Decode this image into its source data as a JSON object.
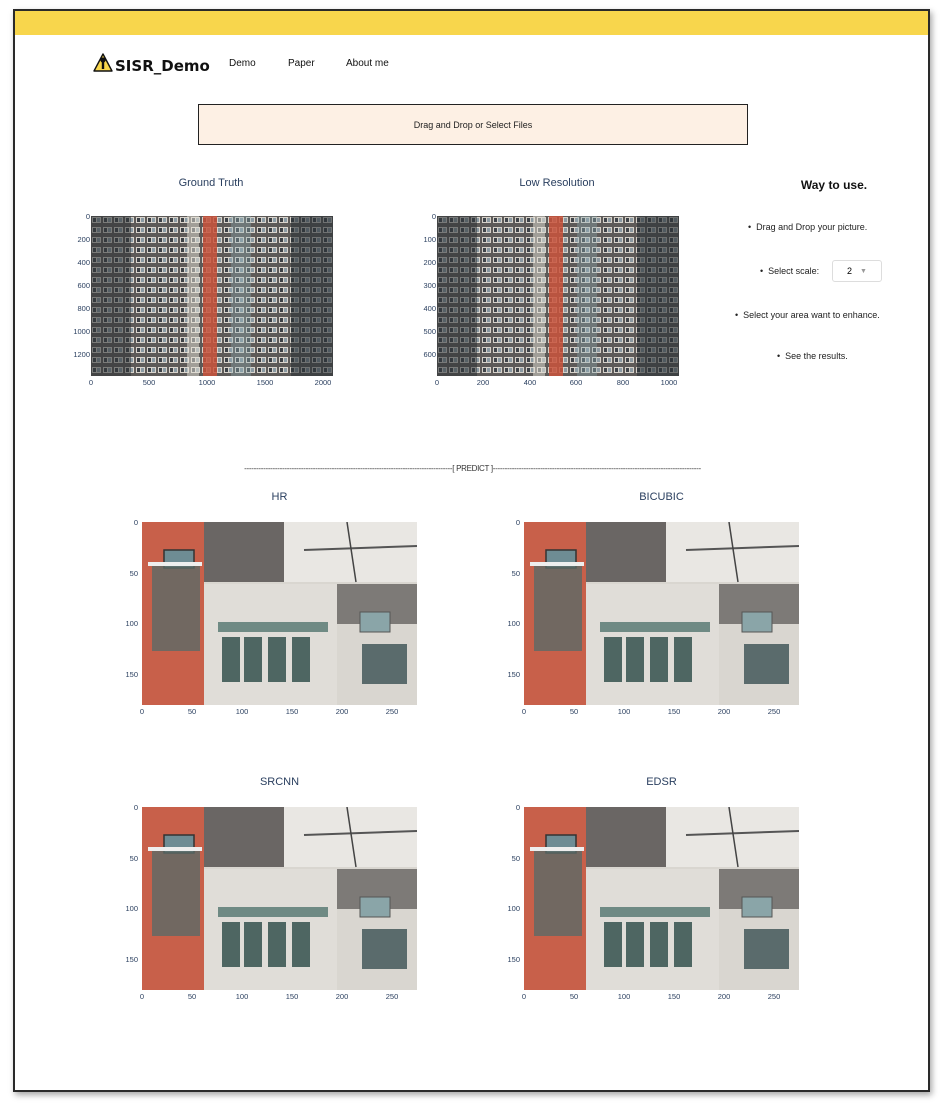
{
  "app": {
    "name": "SISR_Demo"
  },
  "nav": {
    "items": [
      "Demo",
      "Paper",
      "About me"
    ]
  },
  "upload": {
    "label": "Drag and Drop or Select Files"
  },
  "top_plots": [
    {
      "title": "Ground Truth",
      "yticks": [
        "0",
        "200",
        "400",
        "600",
        "800",
        "1000",
        "1200"
      ],
      "xticks": [
        "0",
        "500",
        "1000",
        "1500",
        "2000"
      ]
    },
    {
      "title": "Low Resolution",
      "yticks": [
        "0",
        "100",
        "200",
        "300",
        "400",
        "500",
        "600"
      ],
      "xticks": [
        "0",
        "200",
        "400",
        "600",
        "800",
        "1000"
      ]
    }
  ],
  "instructions": {
    "title": "Way to use.",
    "items": [
      "Drag and Drop your picture.",
      "Select scale:",
      "Select your area want to enhance.",
      "See the results."
    ],
    "scale_value": "2"
  },
  "divider": {
    "label": "[ PREDICT ]"
  },
  "predict_plots": [
    {
      "title": "HR",
      "yticks": [
        "0",
        "50",
        "100",
        "150"
      ],
      "xticks": [
        "0",
        "50",
        "100",
        "150",
        "200",
        "250"
      ]
    },
    {
      "title": "BICUBIC",
      "yticks": [
        "0",
        "50",
        "100",
        "150"
      ],
      "xticks": [
        "0",
        "50",
        "100",
        "150",
        "200",
        "250"
      ]
    },
    {
      "title": "SRCNN",
      "yticks": [
        "0",
        "50",
        "100",
        "150"
      ],
      "xticks": [
        "0",
        "50",
        "100",
        "150",
        "200",
        "250"
      ]
    },
    {
      "title": "EDSR",
      "yticks": [
        "0",
        "50",
        "100",
        "150"
      ],
      "xticks": [
        "0",
        "50",
        "100",
        "150",
        "200",
        "250"
      ]
    }
  ],
  "colors": {
    "accent_bar": "#f8d64c",
    "upload_bg": "#fdf0e4",
    "axis_text": "#2a3f5f"
  }
}
